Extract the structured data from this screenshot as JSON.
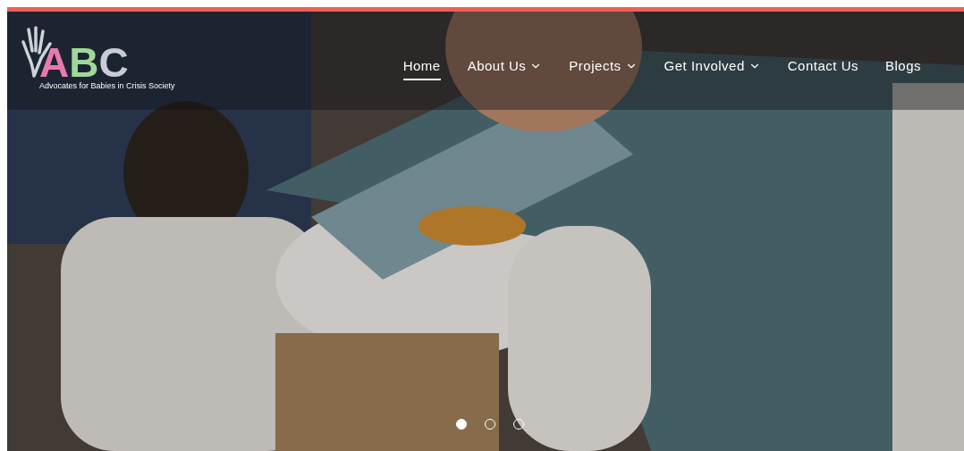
{
  "logo": {
    "letters": [
      {
        "text": "A",
        "color": "#e879b0"
      },
      {
        "text": "B",
        "color": "#9fd89a"
      },
      {
        "text": "C",
        "color": "#c9ccd6"
      }
    ],
    "tagline": "Advocates for Babies in Crisis Society"
  },
  "nav": [
    {
      "label": "Home",
      "selected": true,
      "dropdown": false
    },
    {
      "label": "About Us",
      "selected": false,
      "dropdown": true
    },
    {
      "label": "Projects",
      "selected": false,
      "dropdown": true
    },
    {
      "label": "Get Involved",
      "selected": false,
      "dropdown": true
    },
    {
      "label": "Contact Us",
      "selected": false,
      "dropdown": false
    },
    {
      "label": "Blogs",
      "selected": false,
      "dropdown": false
    }
  ],
  "slides": [
    {
      "selected": true
    },
    {
      "selected": false
    },
    {
      "selected": false
    }
  ]
}
